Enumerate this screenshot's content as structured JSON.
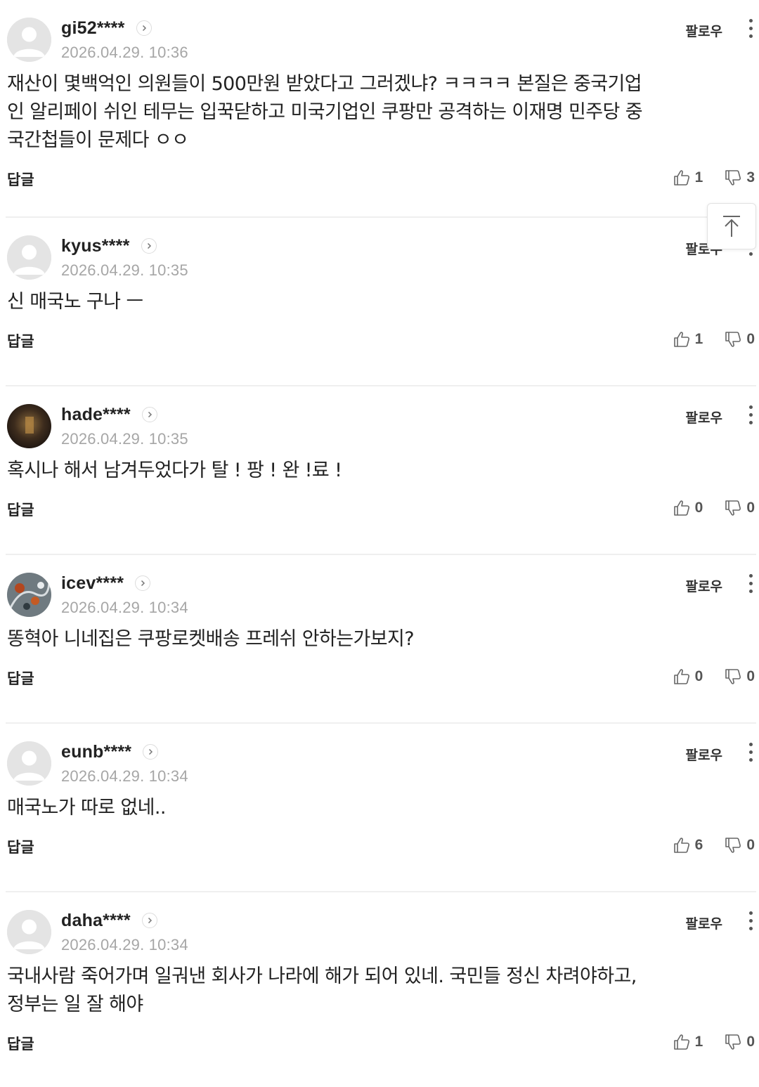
{
  "ui": {
    "follow_label": "팔로우",
    "reply_label": "답글"
  },
  "comments": [
    {
      "username": "gi52****",
      "timestamp": "2026.04.29. 10:36",
      "lines": [
        "재산이 몇백억인 의원들이 500만원 받았다고 그러겠냐? ㅋㅋㅋㅋ 본질은 중국기업",
        "인 알리페이 쉬인 테무는 입꾹닫하고 미국기업인 쿠팡만 공격하는 이재명 민주당 중",
        "국간첩들이 문제다 ㅇㅇ"
      ],
      "likes": "1",
      "dislikes": "3",
      "avatar": "default"
    },
    {
      "username": "kyus****",
      "timestamp": "2026.04.29. 10:35",
      "lines": [
        "신 매국노 구나 ㅡ"
      ],
      "likes": "1",
      "dislikes": "0",
      "avatar": "default"
    },
    {
      "username": "hade****",
      "timestamp": "2026.04.29. 10:35",
      "lines": [
        "혹시나 해서 남겨두었다가 탈 ! 팡 ! 완 !료 !"
      ],
      "likes": "0",
      "dislikes": "0",
      "avatar": "photo-dark"
    },
    {
      "username": "icev****",
      "timestamp": "2026.04.29. 10:34",
      "lines": [
        "똥혁아 니네집은 쿠팡로켓배송 프레쉬 안하는가보지?"
      ],
      "likes": "0",
      "dislikes": "0",
      "avatar": "photo-leaves"
    },
    {
      "username": "eunb****",
      "timestamp": "2026.04.29. 10:34",
      "lines": [
        "매국노가 따로 없네.."
      ],
      "likes": "6",
      "dislikes": "0",
      "avatar": "default"
    },
    {
      "username": "daha****",
      "timestamp": "2026.04.29. 10:34",
      "lines": [
        "국내사람 죽어가며 일궈낸 회사가 나라에 해가 되어 있네. 국민들 정신 차려야하고,",
        "정부는 일 잘 해야"
      ],
      "likes": "1",
      "dislikes": "0",
      "avatar": "default"
    }
  ],
  "icons": {
    "scroll_top": "arrow-up-to-line-icon",
    "like": "thumbs-up-icon",
    "dislike": "thumbs-down-icon",
    "more": "more-vertical-icon",
    "profile_link": "chevron-right-icon"
  }
}
